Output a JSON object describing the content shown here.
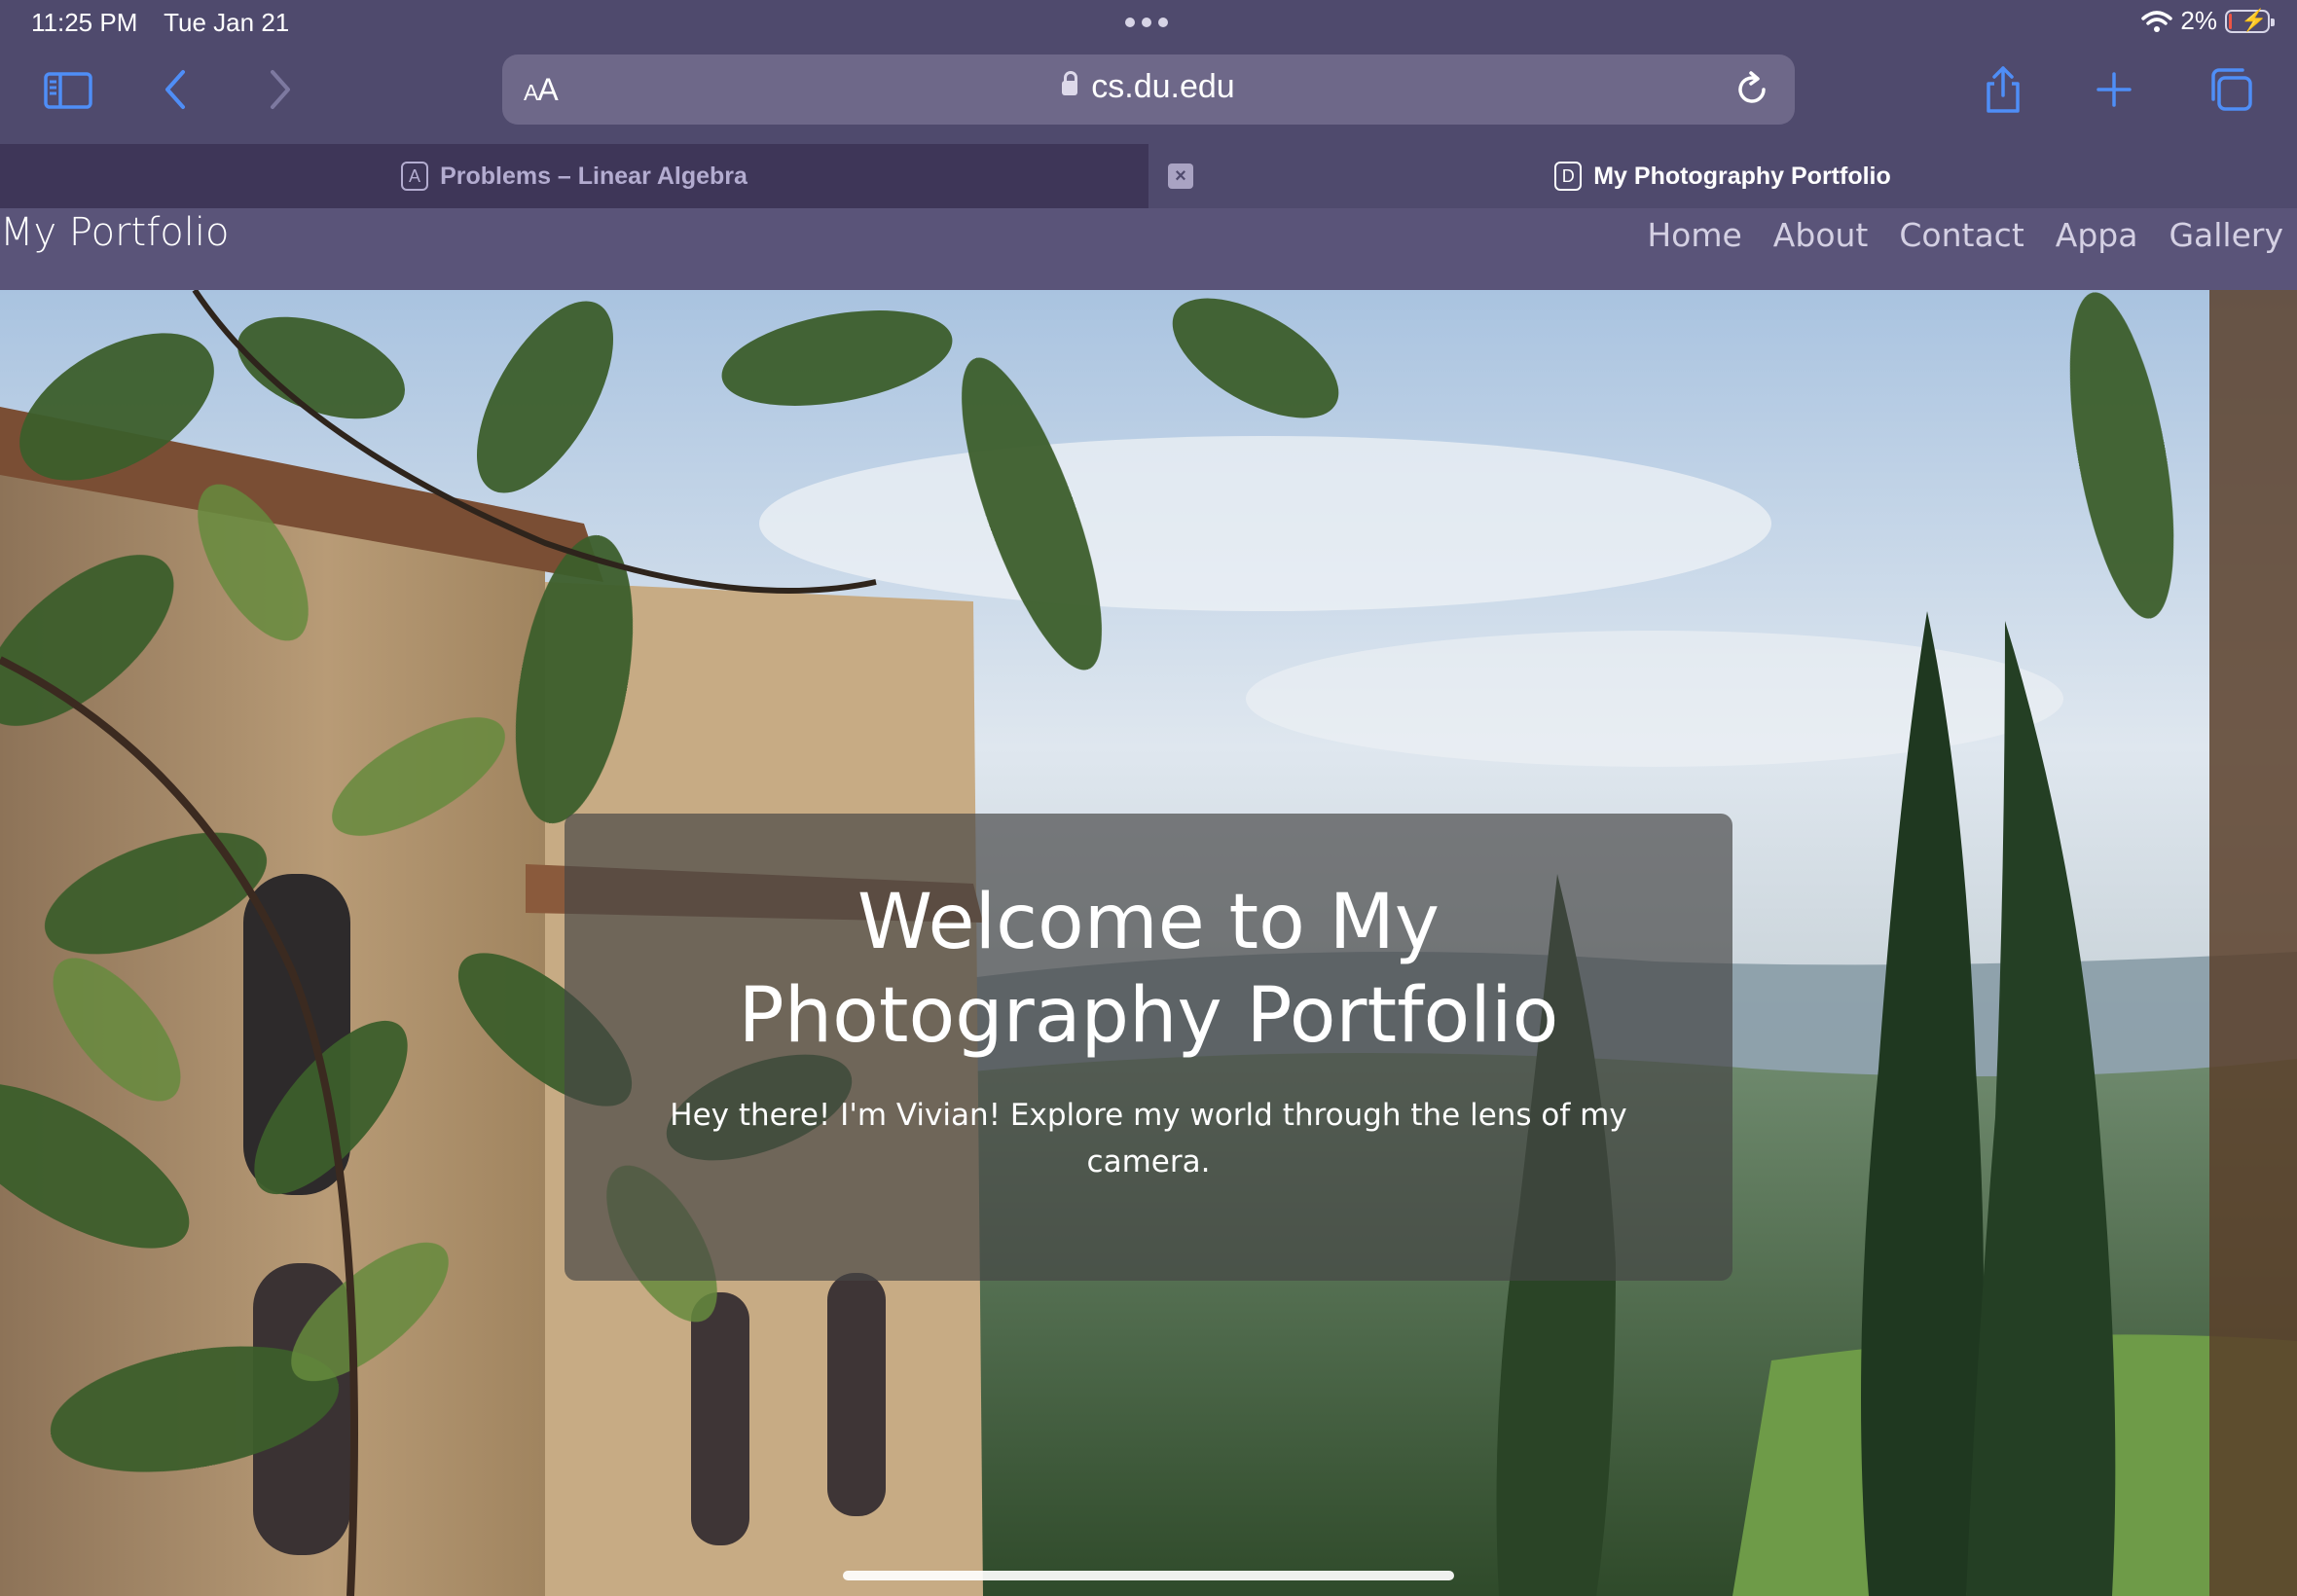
{
  "status_bar": {
    "time": "11:25 PM",
    "date": "Tue Jan 21",
    "battery_percent": "2%",
    "battery_level": 0.02
  },
  "toolbar": {
    "text_size_label_small": "A",
    "text_size_label_large": "A",
    "url": "cs.du.edu",
    "icons": [
      "sidebar-icon",
      "back-icon",
      "forward-icon",
      "lock-icon",
      "reload-icon",
      "share-icon",
      "new-tab-icon",
      "tabs-overview-icon"
    ]
  },
  "tabs": [
    {
      "title": "Problems – Linear Algebra",
      "favicon_letter": "A",
      "active": false
    },
    {
      "title": "My Photography Portfolio",
      "favicon_letter": "D",
      "active": true
    }
  ],
  "site": {
    "brand": "My Portfolio",
    "nav": [
      "Home",
      "About",
      "Contact",
      "Appa",
      "Gallery"
    ],
    "hero": {
      "title": "Welcome to My Photography Portfolio",
      "subtitle": "Hey there! I'm Vivian! Explore my world through the lens of my camera."
    }
  },
  "colors": {
    "chrome": "#4f4a6d",
    "accent_icons": "#4f8ef7",
    "navbar": "#5a5479"
  }
}
